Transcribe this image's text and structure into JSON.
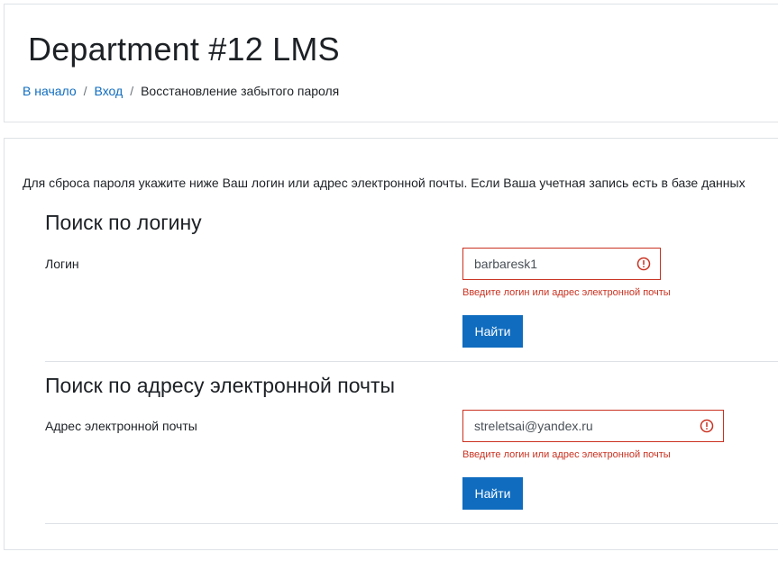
{
  "header": {
    "site_title": "Department #12 LMS",
    "breadcrumb": [
      {
        "label": "В начало"
      },
      {
        "label": "Вход"
      },
      {
        "label": "Восстановление забытого пароля"
      }
    ]
  },
  "main": {
    "intro_text": "Для сброса пароля укажите ниже Ваш логин или адрес электронной почты. Если Ваша учетная запись есть в базе данных",
    "username_section": {
      "title": "Поиск по логину",
      "field_label": "Логин",
      "field_value": "barbaresk1",
      "error_text": "Введите логин или адрес электронной почты",
      "button_label": "Найти"
    },
    "email_section": {
      "title": "Поиск по адресу электронной почты",
      "field_label": "Адрес электронной почты",
      "field_value": "streletsai@yandex.ru",
      "error_text": "Введите логин или адрес электронной почты",
      "button_label": "Найти"
    }
  },
  "icons": {
    "error": "exclamation-circle-icon"
  },
  "colors": {
    "link": "#0f6cbf",
    "primary_button": "#0f6cbf",
    "error": "#ca3120",
    "border": "#dee2e6"
  }
}
